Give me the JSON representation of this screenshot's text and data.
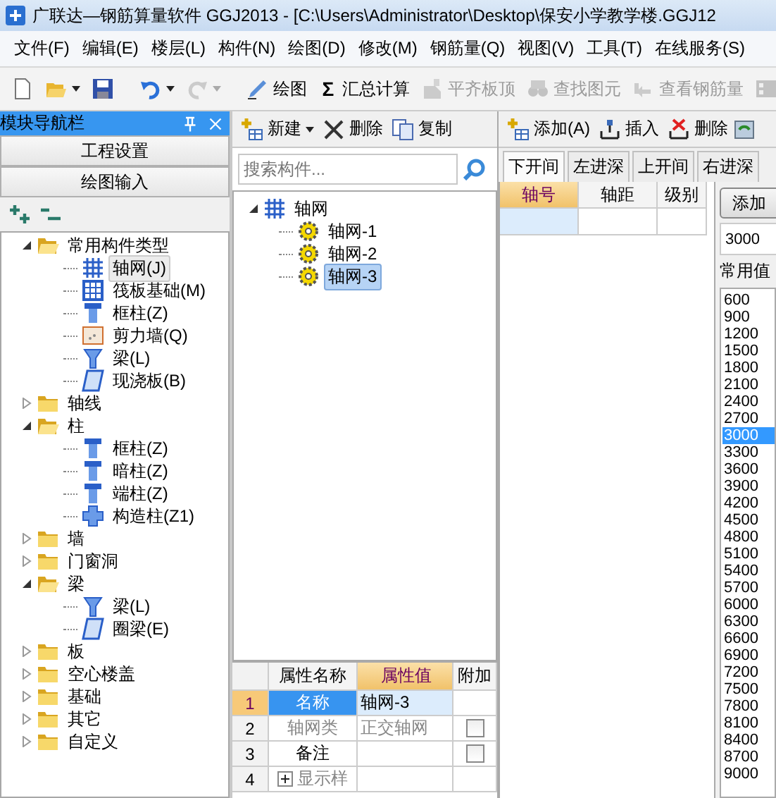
{
  "window": {
    "title": "广联达—钢筋算量软件 GGJ2013 - [C:\\Users\\Administrator\\Desktop\\保安小学教学楼.GGJ12"
  },
  "menu": [
    "文件(F)",
    "编辑(E)",
    "楼层(L)",
    "构件(N)",
    "绘图(D)",
    "修改(M)",
    "钢筋量(Q)",
    "视图(V)",
    "工具(T)",
    "在线服务(S)"
  ],
  "toolbar": [
    {
      "kind": "new",
      "disabled": false,
      "dropdown": false
    },
    {
      "kind": "open",
      "disabled": false,
      "dropdown": true
    },
    {
      "kind": "save",
      "disabled": false,
      "dropdown": false
    },
    {
      "kind": "sep"
    },
    {
      "kind": "undo",
      "disabled": false,
      "dropdown": true
    },
    {
      "kind": "redo",
      "disabled": true,
      "dropdown": true
    },
    {
      "kind": "sep"
    },
    {
      "kind": "draw",
      "label": "绘图",
      "disabled": false,
      "dropdown": false
    },
    {
      "kind": "sum",
      "glyph": "Σ",
      "label": "汇总计算",
      "disabled": false,
      "dropdown": false
    },
    {
      "kind": "align",
      "label": "平齐板顶",
      "disabled": true,
      "dropdown": false
    },
    {
      "kind": "find",
      "label": "查找图元",
      "disabled": true,
      "dropdown": false
    },
    {
      "kind": "view",
      "label": "查看钢筋量",
      "disabled": true,
      "dropdown": false
    },
    {
      "kind": "film",
      "disabled": true,
      "dropdown": false
    }
  ],
  "nav": {
    "title": "模块导航栏",
    "sections": [
      "工程设置",
      "绘图输入"
    ],
    "tree": [
      {
        "kind": "folder",
        "label": "常用构件类型",
        "expanded": true,
        "children": [
          {
            "kind": "grid",
            "label": "轴网(J)",
            "selected": true
          },
          {
            "kind": "raft",
            "label": "筏板基础(M)",
            "selected": false
          },
          {
            "kind": "column",
            "label": "框柱(Z)",
            "selected": false
          },
          {
            "kind": "wall",
            "label": "剪力墙(Q)",
            "selected": false
          },
          {
            "kind": "beam",
            "label": "梁(L)",
            "selected": false
          },
          {
            "kind": "plate",
            "label": "现浇板(B)",
            "selected": false
          }
        ]
      },
      {
        "kind": "folder",
        "label": "轴线",
        "expanded": false
      },
      {
        "kind": "folder",
        "label": "柱",
        "expanded": true,
        "children": [
          {
            "kind": "column",
            "label": "框柱(Z)",
            "selected": false
          },
          {
            "kind": "column",
            "label": "暗柱(Z)",
            "selected": false
          },
          {
            "kind": "column",
            "label": "端柱(Z)",
            "selected": false
          },
          {
            "kind": "cross",
            "label": "构造柱(Z1)",
            "selected": false
          }
        ]
      },
      {
        "kind": "folder",
        "label": "墙",
        "expanded": false
      },
      {
        "kind": "folder",
        "label": "门窗洞",
        "expanded": false
      },
      {
        "kind": "folder",
        "label": "梁",
        "expanded": true,
        "children": [
          {
            "kind": "beam",
            "label": "梁(L)",
            "selected": false
          },
          {
            "kind": "plate",
            "label": "圈梁(E)",
            "selected": false
          }
        ]
      },
      {
        "kind": "folder",
        "label": "板",
        "expanded": false
      },
      {
        "kind": "folder",
        "label": "空心楼盖",
        "expanded": false
      },
      {
        "kind": "folder",
        "label": "基础",
        "expanded": false
      },
      {
        "kind": "folder",
        "label": "其它",
        "expanded": false
      },
      {
        "kind": "folder",
        "label": "自定义",
        "expanded": false
      }
    ]
  },
  "components": {
    "toolbar": [
      {
        "kind": "addtable",
        "label": "新建",
        "dropdown": true
      },
      {
        "kind": "cross-x",
        "label": "删除",
        "dropdown": false
      },
      {
        "kind": "copy",
        "label": "复制",
        "dropdown": false
      }
    ],
    "search": {
      "placeholder": "搜索构件..."
    },
    "tree": [
      {
        "kind": "grid",
        "label": "轴网",
        "expanded": true,
        "selected": false,
        "children": [
          {
            "kind": "gear",
            "label": "轴网-1",
            "selected": false
          },
          {
            "kind": "gear",
            "label": "轴网-2",
            "selected": false
          },
          {
            "kind": "gear",
            "label": "轴网-3",
            "selected": true
          }
        ]
      }
    ]
  },
  "properties": {
    "columns": [
      "属性名称",
      "属性值",
      "附加"
    ],
    "rows": [
      {
        "num": "1",
        "name": "名称",
        "value": "轴网-3",
        "selected": true,
        "disabled": false
      },
      {
        "num": "2",
        "name": "轴网类",
        "value": "正交轴网",
        "selected": false,
        "disabled": true,
        "extra": {
          "checked": false
        }
      },
      {
        "num": "3",
        "name": "备注",
        "selected": false,
        "disabled": false,
        "extra": {
          "checked": false
        }
      },
      {
        "num": "4",
        "name": "显示样",
        "selected": false,
        "disabled": true,
        "expandable": true
      }
    ]
  },
  "axis": {
    "toolbar": [
      {
        "kind": "addtable",
        "label": "添加(A)"
      },
      {
        "kind": "insert",
        "label": "插入"
      },
      {
        "kind": "remove",
        "label": "删除"
      },
      {
        "kind": "refresh"
      }
    ],
    "tabs": [
      {
        "label": "下开间",
        "selected": true
      },
      {
        "label": "左进深",
        "selected": false
      },
      {
        "label": "上开间",
        "selected": false
      },
      {
        "label": "右进深",
        "selected": false
      }
    ],
    "columns": [
      {
        "label": "轴号",
        "selected": true
      },
      {
        "label": "轴距",
        "selected": false
      },
      {
        "label": "级别",
        "selected": false
      }
    ]
  },
  "values": {
    "button": "添加",
    "value": "3000",
    "label": "常用值",
    "items": [
      {
        "label": "600",
        "selected": false
      },
      {
        "label": "900",
        "selected": false
      },
      {
        "label": "1200",
        "selected": false
      },
      {
        "label": "1500",
        "selected": false
      },
      {
        "label": "1800",
        "selected": false
      },
      {
        "label": "2100",
        "selected": false
      },
      {
        "label": "2400",
        "selected": false
      },
      {
        "label": "2700",
        "selected": false
      },
      {
        "label": "3000",
        "selected": true
      },
      {
        "label": "3300",
        "selected": false
      },
      {
        "label": "3600",
        "selected": false
      },
      {
        "label": "3900",
        "selected": false
      },
      {
        "label": "4200",
        "selected": false
      },
      {
        "label": "4500",
        "selected": false
      },
      {
        "label": "4800",
        "selected": false
      },
      {
        "label": "5100",
        "selected": false
      },
      {
        "label": "5400",
        "selected": false
      },
      {
        "label": "5700",
        "selected": false
      },
      {
        "label": "6000",
        "selected": false
      },
      {
        "label": "6300",
        "selected": false
      },
      {
        "label": "6600",
        "selected": false
      },
      {
        "label": "6900",
        "selected": false
      },
      {
        "label": "7200",
        "selected": false
      },
      {
        "label": "7500",
        "selected": false
      },
      {
        "label": "7800",
        "selected": false
      },
      {
        "label": "8100",
        "selected": false
      },
      {
        "label": "8400",
        "selected": false
      },
      {
        "label": "8700",
        "selected": false
      },
      {
        "label": "9000",
        "selected": false
      }
    ]
  }
}
